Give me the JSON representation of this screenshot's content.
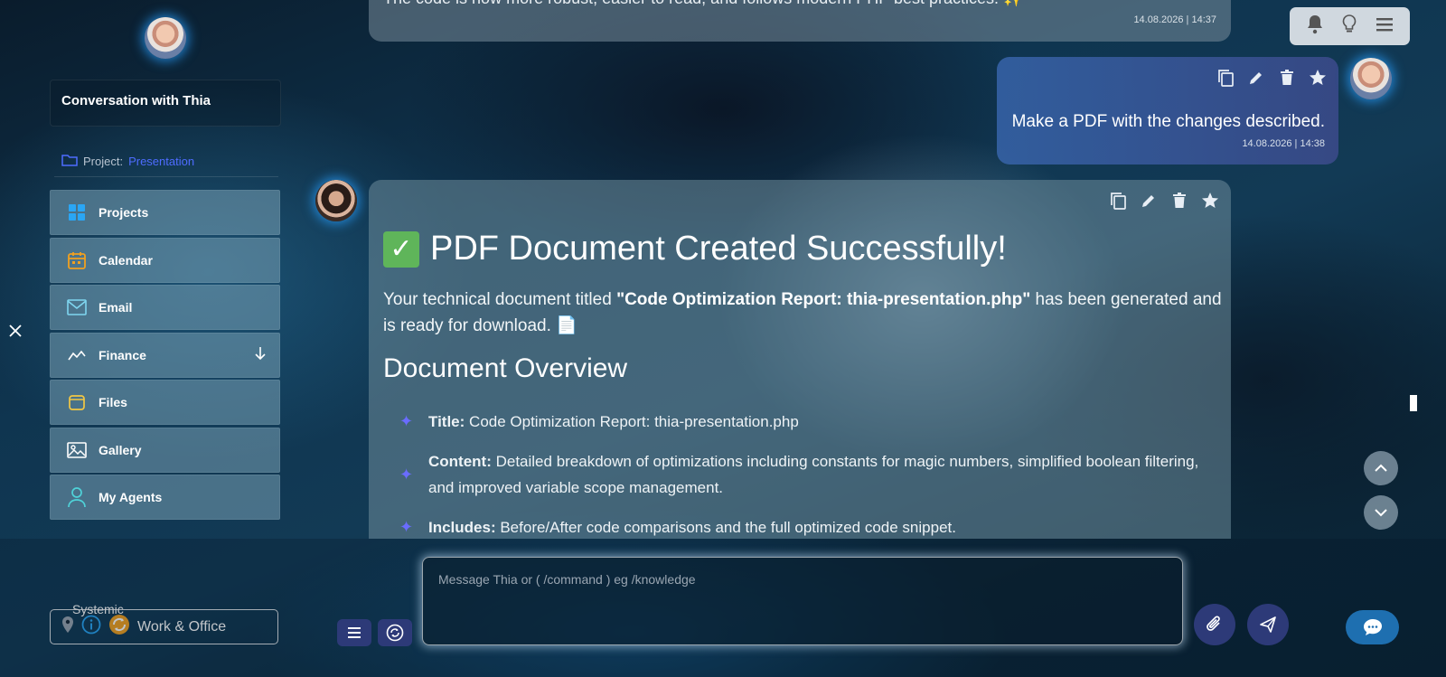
{
  "sidebar": {
    "conversation_title": "Conversation with Thia",
    "project_label": "Project:",
    "project_name": "Presentation",
    "items": [
      {
        "label": "Projects",
        "icon": "grid-icon"
      },
      {
        "label": "Calendar",
        "icon": "calendar-icon"
      },
      {
        "label": "Email",
        "icon": "mail-icon"
      },
      {
        "label": "Finance",
        "icon": "chart-icon",
        "expandable": true
      },
      {
        "label": "Files",
        "icon": "folder-icon"
      },
      {
        "label": "Gallery",
        "icon": "image-icon"
      },
      {
        "label": "My Agents",
        "icon": "person-icon"
      }
    ],
    "systemic_label": "Systemic",
    "workspace_label": "Work & Office"
  },
  "messages": {
    "previous": {
      "text": "The code is now more robust, easier to read, and follows modern PHP best practices. ✨",
      "timestamp": "14.08.2026 | 14:37"
    },
    "user": {
      "text": "Make a PDF with the changes described.",
      "timestamp": "14.08.2026 | 14:38"
    },
    "bot": {
      "heading": "PDF Document Created Successfully!",
      "intro_before": "Your technical document titled ",
      "intro_bold": "\"Code Optimization Report: thia-presentation.php\"",
      "intro_after": " has been generated and is ready for download. 📄",
      "overview_heading": "Document Overview",
      "bullets": [
        {
          "label": "Title:",
          "text": " Code Optimization Report: thia-presentation.php"
        },
        {
          "label": "Content:",
          "text": " Detailed breakdown of optimizations including constants for magic numbers, simplified boolean filtering, and improved variable scope management."
        },
        {
          "label": "Includes:",
          "text": " Before/After code comparisons and the full optimized code snippet."
        }
      ]
    }
  },
  "composer": {
    "placeholder": "Message Thia or ( /command ) eg /knowledge"
  },
  "colors": {
    "accent": "#4e6cff",
    "bullet_star": "#6a6cff",
    "button_bg": "#2d3a78",
    "fab_bg": "#1e6fb0",
    "success_check": "#5fb55a"
  }
}
